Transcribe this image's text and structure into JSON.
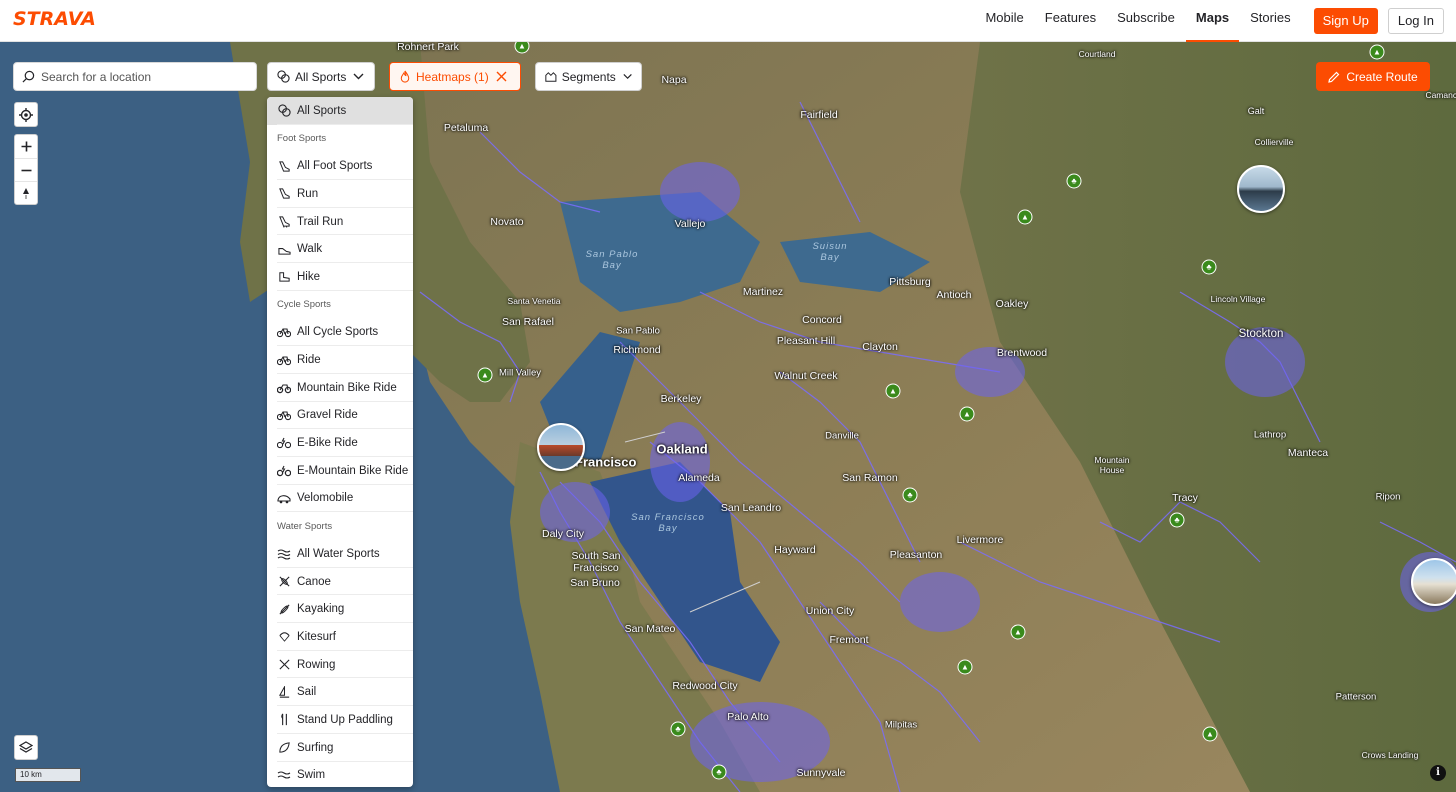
{
  "app": {
    "logo": "STRAVA"
  },
  "nav": {
    "links": [
      "Mobile",
      "Features",
      "Subscribe",
      "Maps",
      "Stories"
    ],
    "active": "Maps",
    "signup_label": "Sign Up",
    "login_label": "Log In"
  },
  "search": {
    "placeholder": "Search for a location",
    "value": ""
  },
  "filters": {
    "sports_label": "All Sports",
    "heatmaps_label": "Heatmaps (1)",
    "segments_label": "Segments",
    "create_route_label": "Create Route"
  },
  "dropdown": {
    "selected": "All Sports",
    "top": "All Sports",
    "foot_heading": "Foot Sports",
    "foot": [
      "All Foot Sports",
      "Run",
      "Trail Run",
      "Walk",
      "Hike"
    ],
    "cycle_heading": "Cycle Sports",
    "cycle": [
      "All Cycle Sports",
      "Ride",
      "Mountain Bike Ride",
      "Gravel Ride",
      "E-Bike Ride",
      "E-Mountain Bike Ride",
      "Velomobile"
    ],
    "water_heading": "Water Sports",
    "water": [
      "All Water Sports",
      "Canoe",
      "Kayaking",
      "Kitesurf",
      "Rowing",
      "Sail",
      "Stand Up Paddling",
      "Surfing",
      "Swim"
    ]
  },
  "map": {
    "scale_label": "10 km",
    "info_label": "i",
    "places": [
      "Rohnert Park",
      "Napa",
      "Courtland",
      "Galt",
      "Petaluma",
      "Fairfield",
      "Collierville",
      "Camanche",
      "Novato",
      "Vallejo",
      "Santa Venetia",
      "San Rafael",
      "Martinez",
      "Pittsburg",
      "Antioch",
      "Oakley",
      "Lincoln Village",
      "Stockton",
      "San Pablo",
      "Richmond",
      "Concord",
      "Pleasant Hill",
      "Clayton",
      "Brentwood",
      "Mill Valley",
      "Walnut Creek",
      "Berkeley",
      "Danville",
      "San Francisco",
      "Oakland",
      "Alameda",
      "San Ramon",
      "Lathrop",
      "Manteca",
      "Mountain House",
      "San Leandro",
      "Tracy",
      "Ripon",
      "Daly City",
      "South San Francisco",
      "Hayward",
      "Pleasanton",
      "Livermore",
      "San Bruno",
      "Union City",
      "San Mateo",
      "Fremont",
      "Redwood City",
      "Palo Alto",
      "Milpitas",
      "Patterson",
      "Sunnyvale",
      "Crows Landing"
    ],
    "water_labels": [
      "San Pablo Bay",
      "Suisun Bay",
      "San Francisco Bay"
    ]
  },
  "colors": {
    "brand": "#fc4c02",
    "heat": "#7a6cff",
    "water": "#3c6083",
    "land": "#8a7a55"
  }
}
